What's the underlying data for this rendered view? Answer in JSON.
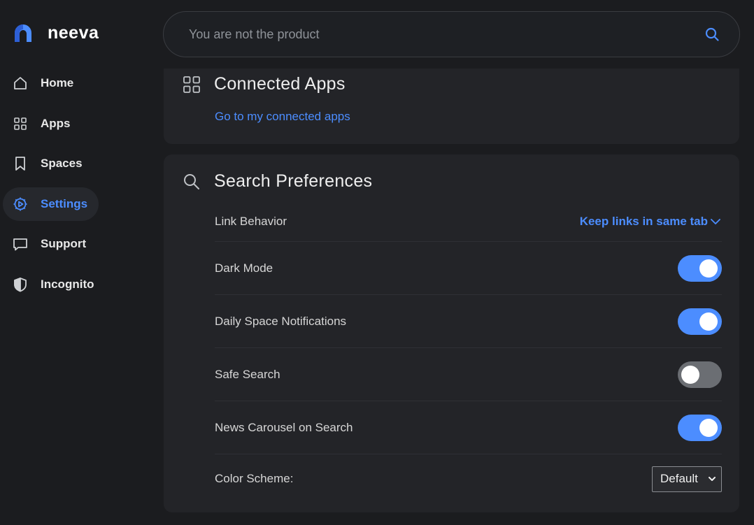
{
  "brand": {
    "name": "neeva",
    "accent": "#4c8dff"
  },
  "sidebar": {
    "items": [
      {
        "label": "Home",
        "icon": "home-icon"
      },
      {
        "label": "Apps",
        "icon": "apps-grid-icon"
      },
      {
        "label": "Spaces",
        "icon": "bookmark-icon"
      },
      {
        "label": "Settings",
        "icon": "settings-gear-icon",
        "active": true
      },
      {
        "label": "Support",
        "icon": "chat-bubble-icon"
      },
      {
        "label": "Incognito",
        "icon": "shield-icon"
      }
    ]
  },
  "search": {
    "placeholder": "You are not the product",
    "value": ""
  },
  "connected_apps": {
    "title": "Connected Apps",
    "link": "Go to my connected apps"
  },
  "search_preferences": {
    "title": "Search Preferences",
    "link_behavior": {
      "label": "Link Behavior",
      "value": "Keep links in same tab"
    },
    "dark_mode": {
      "label": "Dark Mode",
      "enabled": true
    },
    "daily_space_notifications": {
      "label": "Daily Space Notifications",
      "enabled": true
    },
    "safe_search": {
      "label": "Safe Search",
      "enabled": false
    },
    "news_carousel": {
      "label": "News Carousel on Search",
      "enabled": true
    },
    "color_scheme": {
      "label": "Color Scheme:",
      "value": "Default"
    }
  }
}
